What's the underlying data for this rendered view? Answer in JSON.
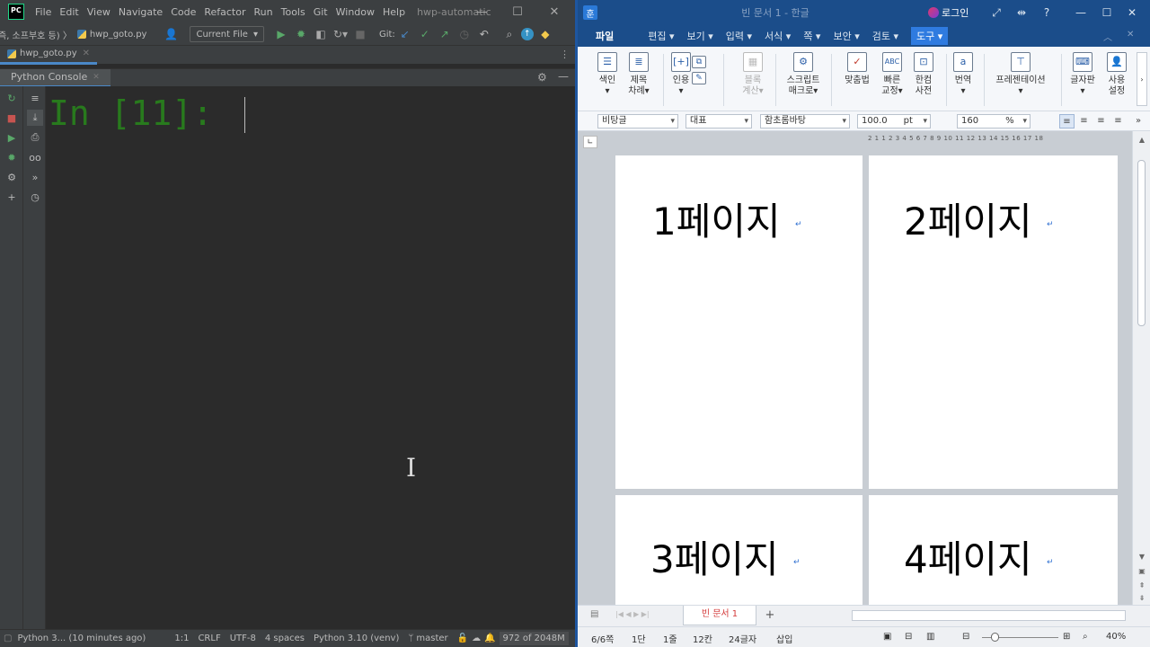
{
  "ide": {
    "menu": [
      "File",
      "Edit",
      "View",
      "Navigate",
      "Code",
      "Refactor",
      "Run",
      "Tools",
      "Git",
      "Window",
      "Help"
    ],
    "window_title": "hwp-automatic",
    "breadcrumb": "즉, 소프부호 등) 〉",
    "breadcrumb_file": "hwp_goto.py",
    "run_config": "Current File",
    "git_label": "Git:",
    "file_tab": "hwp_goto.py",
    "console_tab": "Python Console",
    "prompt": "In [11]: ",
    "status": {
      "left": "Python 3... (10 minutes ago)",
      "position": "1:1",
      "line_sep": "CRLF",
      "encoding": "UTF-8",
      "indent": "4 spaces",
      "interpreter": "Python 3.10 (venv)",
      "branch": "master",
      "memory": "972 of 2048M"
    }
  },
  "hwp": {
    "title": "빈 문서 1 - 한글",
    "login": "로그인",
    "menu": {
      "file": "파일",
      "items": [
        "편집 ▾",
        "보기 ▾",
        "입력 ▾",
        "서식 ▾",
        "쪽 ▾",
        "보안 ▾",
        "검토 ▾"
      ],
      "active": "도구 ▾"
    },
    "ribbon": [
      {
        "label1": "색인",
        "label2": "▾",
        "icon": "index-icon"
      },
      {
        "label1": "제목",
        "label2": "차례▾",
        "icon": "toc-icon"
      },
      {
        "label1": "인용",
        "label2": "▾",
        "icon": "quote-icon"
      },
      {
        "label1": "블록",
        "label2": "계산▾",
        "icon": "block-calc-icon"
      },
      {
        "label1": "스크립트",
        "label2": "매크로▾",
        "icon": "macro-icon"
      },
      {
        "label1": "맞춤법",
        "label2": "",
        "icon": "spellcheck-icon"
      },
      {
        "label1": "빠른",
        "label2": "교정▾",
        "icon": "autocorrect-icon"
      },
      {
        "label1": "한컴",
        "label2": "사전",
        "icon": "dictionary-icon"
      },
      {
        "label1": "번역",
        "label2": "▾",
        "icon": "translate-icon"
      },
      {
        "label1": "프레젠테이션",
        "label2": "▾",
        "icon": "presentation-icon"
      },
      {
        "label1": "글자판",
        "label2": "▾",
        "icon": "keyboard-icon"
      },
      {
        "label1": "사용",
        "label2": "설정",
        "icon": "user-settings-icon"
      }
    ],
    "format": {
      "style": "비탕글",
      "lang": "대표",
      "font": "함초롬바탕",
      "size": "100.0",
      "unit": "pt",
      "ratio": "160",
      "pct": "%"
    },
    "ruler": "2 1 1 2 3 4 5 6 7 8 9 10 11 12 13 14 15 16 17 18",
    "pages": [
      "1페이지",
      "2페이지",
      "3페이지",
      "4페이지"
    ],
    "sheet_tab": "빈 문서 1",
    "status": {
      "page": "6/6쪽",
      "section": "1단",
      "line": "1줄",
      "col": "12칸",
      "chars": "24글자",
      "mode": "삽입",
      "zoom": "40%"
    }
  }
}
